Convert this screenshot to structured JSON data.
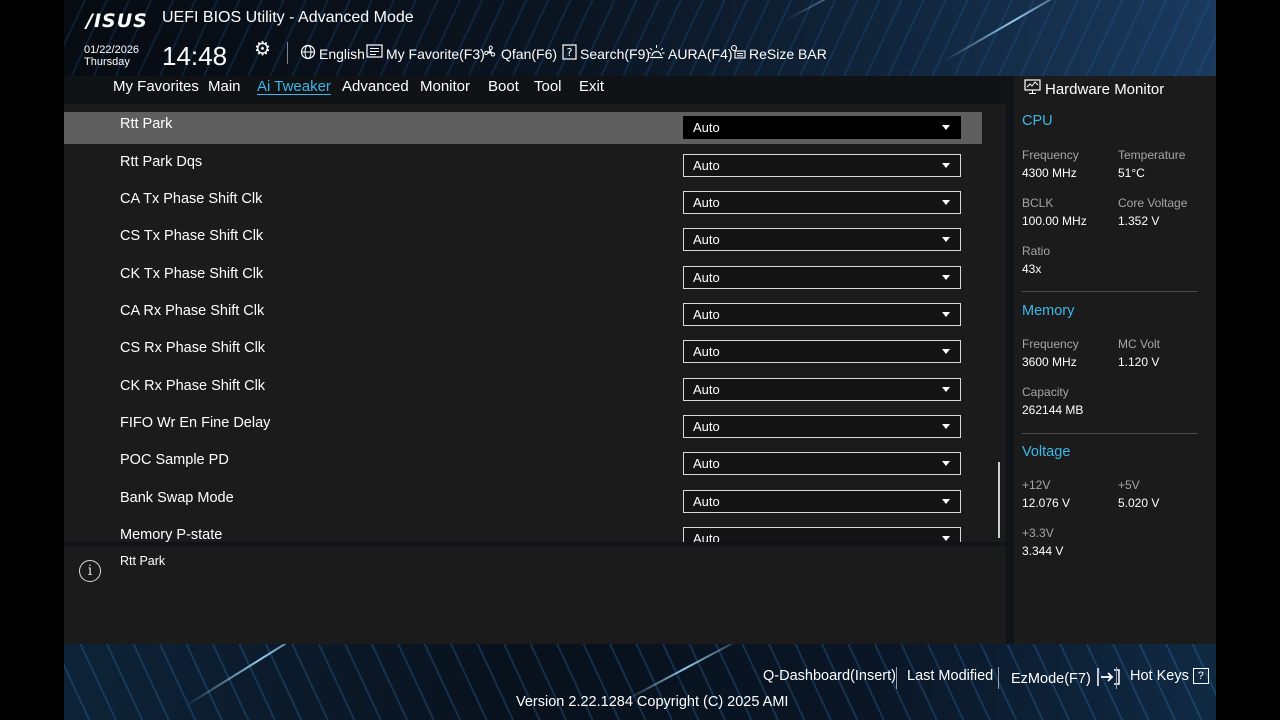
{
  "header": {
    "logo": "/ISUS",
    "title": "UEFI BIOS Utility - Advanced Mode",
    "date": "01/22/2026",
    "day": "Thursday",
    "time": "14:48",
    "items": [
      {
        "label": "English",
        "icon": "globe-icon"
      },
      {
        "label": "My Favorite(F3)",
        "icon": "favorite-icon"
      },
      {
        "label": "Qfan(F6)",
        "icon": "fan-icon"
      },
      {
        "label": "Search(F9)",
        "icon": "search-icon"
      },
      {
        "label": "AURA(F4)",
        "icon": "aura-icon"
      },
      {
        "label": "ReSize BAR",
        "icon": "resize-bar-icon"
      }
    ]
  },
  "nav": {
    "tabs": [
      "My Favorites",
      "Main",
      "Ai Tweaker",
      "Advanced",
      "Monitor",
      "Boot",
      "Tool",
      "Exit"
    ],
    "active": "Ai Tweaker"
  },
  "settings": [
    {
      "label": "Rtt Park",
      "value": "Auto"
    },
    {
      "label": "Rtt Park Dqs",
      "value": "Auto"
    },
    {
      "label": "CA Tx Phase Shift Clk",
      "value": "Auto"
    },
    {
      "label": "CS Tx Phase Shift Clk",
      "value": "Auto"
    },
    {
      "label": "CK Tx Phase Shift Clk",
      "value": "Auto"
    },
    {
      "label": "CA Rx Phase Shift Clk",
      "value": "Auto"
    },
    {
      "label": "CS Rx Phase Shift Clk",
      "value": "Auto"
    },
    {
      "label": "CK Rx Phase Shift Clk",
      "value": "Auto"
    },
    {
      "label": "FIFO Wr En Fine Delay",
      "value": "Auto"
    },
    {
      "label": "POC Sample PD",
      "value": "Auto"
    },
    {
      "label": "Bank Swap Mode",
      "value": "Auto"
    },
    {
      "label": "Memory P-state",
      "value": "Auto"
    }
  ],
  "help": {
    "text": "Rtt Park"
  },
  "hw": {
    "title": "Hardware Monitor",
    "cpu": {
      "heading": "CPU",
      "frequency_label": "Frequency",
      "frequency": "4300 MHz",
      "temperature_label": "Temperature",
      "temperature": "51°C",
      "bclk_label": "BCLK",
      "bclk": "100.00 MHz",
      "core_voltage_label": "Core Voltage",
      "core_voltage": "1.352 V",
      "ratio_label": "Ratio",
      "ratio": "43x"
    },
    "memory": {
      "heading": "Memory",
      "frequency_label": "Frequency",
      "frequency": "3600 MHz",
      "mc_volt_label": "MC Volt",
      "mc_volt": "1.120 V",
      "capacity_label": "Capacity",
      "capacity": "262144 MB"
    },
    "voltage": {
      "heading": "Voltage",
      "v12_label": "+12V",
      "v12": "12.076 V",
      "v5_label": "+5V",
      "v5": "5.020 V",
      "v33_label": "+3.3V",
      "v33": "3.344 V"
    }
  },
  "footer": {
    "q_dashboard": "Q-Dashboard(Insert)",
    "last_modified": "Last Modified",
    "ezmode": "EzMode(F7)",
    "hot_keys": "Hot Keys",
    "hot_keys_icon": "?",
    "version": "Version 2.22.1284 Copyright (C) 2025 AMI"
  },
  "colors": {
    "accent": "#3fb6e8",
    "selected_row": "#5f5f5f",
    "panel": "#1b1b1b"
  }
}
